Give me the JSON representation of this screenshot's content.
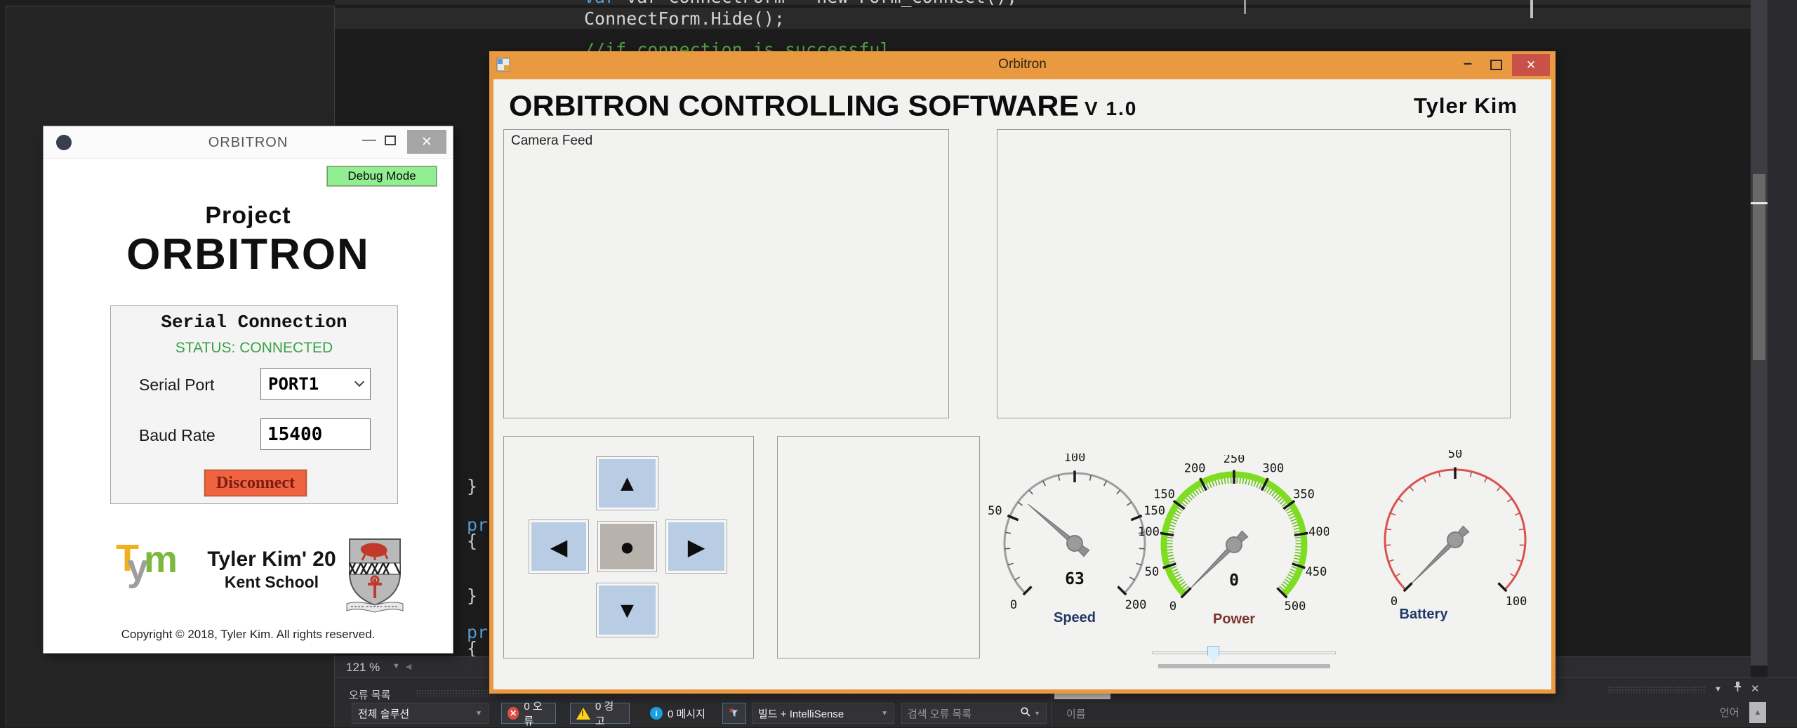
{
  "ide": {
    "editor": {
      "code_line_top": "var ConnectForm = new Form_Connect();",
      "code_line_2": "ConnectForm.Hide();",
      "comment_line": "//if connection is successful",
      "fragments": [
        "}",
        "pri",
        "{",
        "}",
        "pri",
        "{"
      ],
      "zoom_level": "121 %",
      "zoom_caret": "▼",
      "hscroll_left_arrow": "◄"
    },
    "error_list": {
      "panel_title": "오류 목록",
      "scope_dropdown": "전체 솔루션",
      "errors_button": "0 오류",
      "warnings_button": "0 경고",
      "messages_button": "0 메시지",
      "build_dropdown": "빌드 + IntelliSense",
      "search_placeholder": "검색 오류 목록",
      "error_icon_glyph": "✕",
      "info_icon_glyph": "i",
      "caret_glyph": "▼",
      "panel_caret": "▼",
      "panel_close": "✕"
    },
    "right_dock": {
      "name_column": "이름",
      "language_column": "언어",
      "sort_glyph": "▲"
    }
  },
  "connect_window": {
    "title": "ORBITRON",
    "minimize_glyph": "—",
    "close_glyph": "✕",
    "debug_button": "Debug Mode",
    "project_line1": "Project",
    "project_line2": "ORBITRON",
    "serial_group": {
      "title": "Serial Connection",
      "status": "STATUS: CONNECTED",
      "serial_port_label": "Serial Port",
      "serial_port_value": "PORT1",
      "baud_rate_label": "Baud Rate",
      "baud_rate_value": "15400",
      "disconnect_button": "Disconnect"
    },
    "footer": {
      "logo_t": "T",
      "logo_y": "y",
      "logo_m": "m",
      "author": "Tyler Kim' 20",
      "school": "Kent School",
      "copyright": "Copyright © 2018, Tyler Kim. All rights reserved."
    }
  },
  "main_window": {
    "title": "Orbitron",
    "minimize_glyph": "–",
    "close_glyph": "✕",
    "header_title": "ORBITRON CONTROLLING SOFTWARE",
    "version": "V 1.0",
    "author": "Tyler Kim",
    "camera_feed_label": "Camera Feed",
    "dpad": {
      "up": "▲",
      "left": "◀",
      "center": "●",
      "right": "▶",
      "down": "▼"
    },
    "gauges": [
      {
        "id": "speed",
        "label": "Speed",
        "min": 0,
        "max": 200,
        "value": 63,
        "value_text": "63",
        "show_value": true,
        "label_step": 50,
        "major_step": 50,
        "minor_step": 10,
        "arc_color": "#9e9e9e",
        "arc_width": 3,
        "minor_color": "#5a5a5a",
        "label_color": "#1f3864"
      },
      {
        "id": "power",
        "label": "Power",
        "min": 0,
        "max": 500,
        "value": 0,
        "value_text": "0",
        "show_value": true,
        "label_step": 50,
        "major_step": 50,
        "minor_step": 5,
        "arc_color": "#7edd20",
        "arc_width": 9,
        "minor_color": "#69c01b",
        "label_color": "#7b342a"
      },
      {
        "id": "battery",
        "label": "Battery",
        "min": 0,
        "max": 100,
        "value": 0,
        "value_text": "",
        "show_value": false,
        "label_step": 50,
        "major_step": 50,
        "minor_step": 5,
        "arc_color": "#d9534f",
        "arc_width": 3,
        "minor_color": "#c4504a",
        "label_color": "#1f3864"
      }
    ]
  },
  "colors": {
    "window_chrome": "#e9993f",
    "close_button": "#ca5148",
    "debug_green": "#92ee92",
    "status_green": "#3aa047",
    "disconnect_orange": "#ef6340",
    "dpad_blue": "#b8cce4",
    "editor_bg": "#1c1c1c",
    "panel_bg": "#2b2b2e"
  }
}
